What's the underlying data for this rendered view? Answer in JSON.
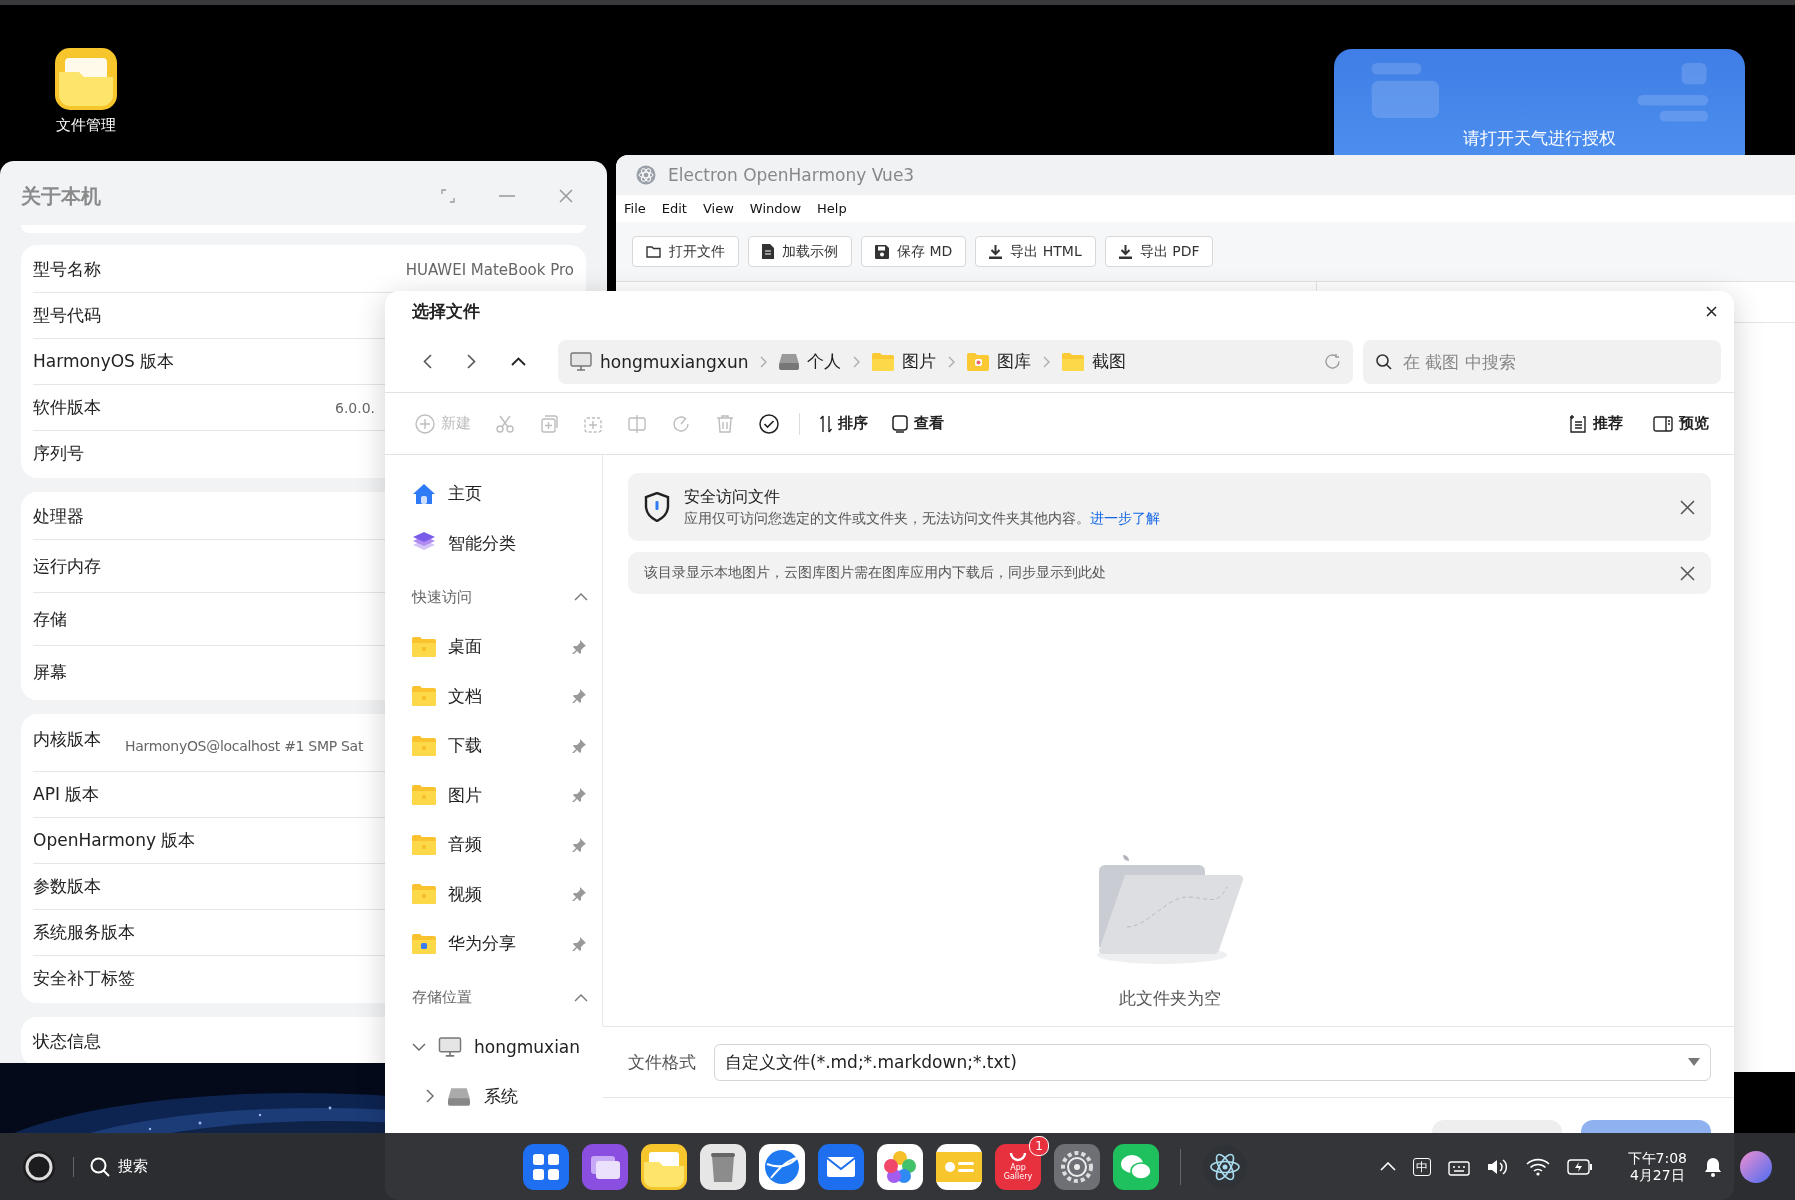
{
  "desktop": {
    "icons": [
      {
        "label": "文件管理"
      }
    ],
    "weather_widget": {
      "text": "请打开天气进行授权"
    }
  },
  "about_window": {
    "title": "关于本机",
    "cards": [
      [
        {
          "label": "型号名称",
          "value": "HUAWEI MateBook Pro"
        },
        {
          "label": "型号代码"
        },
        {
          "label": "HarmonyOS 版本"
        },
        {
          "label": "软件版本",
          "value": "6.0.0."
        },
        {
          "label": "序列号"
        }
      ],
      [
        {
          "label": "处理器"
        },
        {
          "label": "运行内存"
        },
        {
          "label": "存储"
        },
        {
          "label": "屏幕"
        }
      ],
      [
        {
          "label": "内核版本",
          "value": "HarmonyOS@localhost #1 SMP Sat"
        },
        {
          "label": "API 版本"
        },
        {
          "label": "OpenHarmony 版本"
        },
        {
          "label": "参数版本"
        },
        {
          "label": "系统服务版本"
        },
        {
          "label": "安全补丁标签"
        }
      ],
      [
        {
          "label": "状态信息"
        }
      ]
    ]
  },
  "editor_window": {
    "title": "Electron OpenHarmony Vue3",
    "menu": [
      "File",
      "Edit",
      "View",
      "Window",
      "Help"
    ],
    "toolbar": [
      {
        "kind": "open",
        "label": "打开文件"
      },
      {
        "kind": "load",
        "label": "加载示例"
      },
      {
        "kind": "save",
        "label": "保存 MD"
      },
      {
        "kind": "export",
        "label": "导出 HTML"
      },
      {
        "kind": "export",
        "label": "导出 PDF"
      }
    ]
  },
  "file_dialog": {
    "title": "选择文件",
    "breadcrumb": [
      {
        "kind": "computer",
        "label": "hongmuxiangxun"
      },
      {
        "kind": "drive",
        "label": "个人"
      },
      {
        "kind": "folder",
        "label": "图片"
      },
      {
        "kind": "gallery",
        "label": "图库"
      },
      {
        "kind": "folder",
        "label": "截图"
      }
    ],
    "search": {
      "placeholder": "在 截图 中搜索"
    },
    "toolbar": [
      {
        "kind": "new",
        "label": "新建",
        "disabled": true
      },
      {
        "kind": "cut",
        "disabled": true
      },
      {
        "kind": "copy",
        "disabled": true
      },
      {
        "kind": "paste",
        "disabled": true
      },
      {
        "kind": "rename",
        "disabled": true
      },
      {
        "kind": "rotate",
        "disabled": true
      },
      {
        "kind": "delete",
        "disabled": true
      },
      {
        "kind": "select",
        "disabled": false
      },
      {
        "kind": "sort",
        "label": "排序",
        "disabled": false
      },
      {
        "kind": "view",
        "label": "查看",
        "disabled": false
      }
    ],
    "toolbar_right": [
      {
        "kind": "recommend",
        "label": "推荐"
      },
      {
        "kind": "preview",
        "label": "预览"
      }
    ],
    "sidebar": {
      "top": [
        {
          "kind": "home",
          "label": "主页"
        },
        {
          "kind": "smart",
          "label": "智能分类"
        }
      ],
      "sections": [
        {
          "title": "快速访问",
          "expanded": true,
          "items": [
            {
              "label": "桌面",
              "kind": "folder",
              "pinned": true
            },
            {
              "label": "文档",
              "kind": "folder",
              "pinned": true
            },
            {
              "label": "下载",
              "kind": "folder",
              "pinned": true
            },
            {
              "label": "图片",
              "kind": "folder",
              "pinned": true
            },
            {
              "label": "音频",
              "kind": "folder",
              "pinned": true
            },
            {
              "label": "视频",
              "kind": "folder",
              "pinned": true
            },
            {
              "label": "华为分享",
              "kind": "share",
              "pinned": true
            }
          ]
        },
        {
          "title": "存储位置",
          "expanded": true,
          "tree": [
            {
              "label": "hongmuxian",
              "kind": "computer",
              "expanded": true,
              "children": [
                {
                  "label": "系统",
                  "kind": "drive",
                  "expanded": false
                }
              ]
            }
          ]
        }
      ]
    },
    "banners": [
      {
        "kind": "security",
        "title": "安全访问文件",
        "text": "应用仅可访问您选定的文件或文件夹，无法访问文件夹其他内容。",
        "link": "进一步了解"
      },
      {
        "kind": "info",
        "text": "该目录显示本地图片，云图库图片需在图库应用内下载后，同步显示到此处"
      }
    ],
    "empty_text": "此文件夹为空",
    "file_format": {
      "label": "文件格式",
      "value": "自定义文件(*.md;*.markdown;*.txt)"
    }
  },
  "taskbar": {
    "search": "搜索",
    "apps": [
      {
        "kind": "launcher"
      },
      {
        "kind": "multitask"
      },
      {
        "kind": "files"
      },
      {
        "kind": "trash"
      },
      {
        "kind": "browser"
      },
      {
        "kind": "mail"
      },
      {
        "kind": "photos"
      },
      {
        "kind": "notes"
      },
      {
        "kind": "appgallery",
        "label": "App Gallery",
        "badge": "1"
      },
      {
        "kind": "settings"
      },
      {
        "kind": "chat"
      },
      {
        "kind": "electron",
        "separator_before": true
      }
    ],
    "tray": {
      "ime": "中",
      "time": "下午7:08",
      "date": "4月27日"
    }
  }
}
